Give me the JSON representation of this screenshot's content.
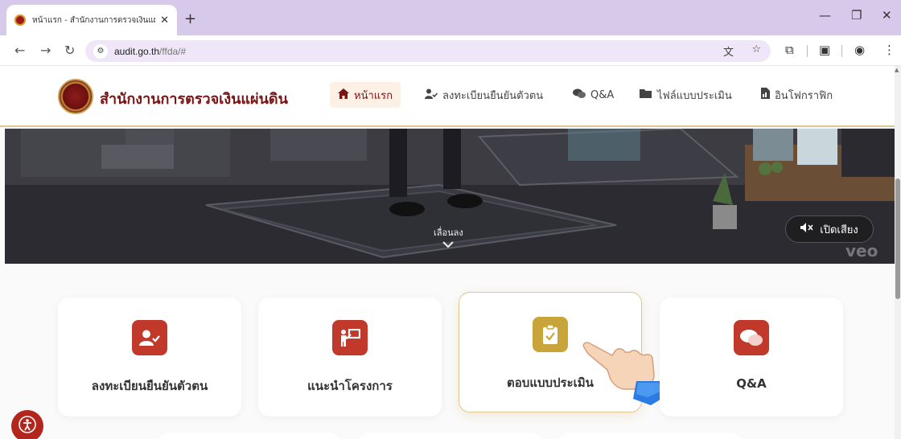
{
  "browser": {
    "tab_title": "หน้าแรก - สำนักงานการตรวจเงินแผ่นดิน",
    "tab_close": "✕",
    "new_tab": "+",
    "url_host": "audit.go.th",
    "url_path": "/ffda/#",
    "icons": [
      "back-icon",
      "forward-icon",
      "reload-icon",
      "site-info-icon",
      "translate-icon",
      "star-icon",
      "extensions-icon",
      "reading-list-icon",
      "profile-icon",
      "menu-icon"
    ]
  },
  "site": {
    "logo_text": "สำนักงานการตรวจเงินแผ่นดิน",
    "nav": [
      {
        "label": "หน้าแรก",
        "icon": "home-icon"
      },
      {
        "label": "ลงทะเบียนยืนยันตัวตน",
        "icon": "user-check-icon"
      },
      {
        "label": "Q&A",
        "icon": "chat-icon"
      },
      {
        "label": "ไฟล์แบบประเมิน",
        "icon": "folder-icon"
      },
      {
        "label": "อินโฟกราฟิก",
        "icon": "infographic-icon"
      }
    ]
  },
  "hero": {
    "scroll_label": "เลื่อนลง",
    "sound_button": "เปิดเสียง",
    "watermark": "veo"
  },
  "cards": [
    {
      "label": "ลงทะเบียนยืนยันตัวตน",
      "icon": "user-check-icon",
      "color": "#c0392b"
    },
    {
      "label": "แนะนำโครงการ",
      "icon": "presentation-icon",
      "color": "#c0392b"
    },
    {
      "label": "ตอบแบบประเมิน",
      "icon": "clipboard-check-icon",
      "color": "#c9a43b"
    },
    {
      "label": "Q&A",
      "icon": "chat-icon",
      "color": "#c0392b"
    }
  ],
  "colors": {
    "brand": "#7a1515",
    "accent": "#c0392b",
    "gold": "#c9a43b",
    "chrome": "#d7c9ea"
  }
}
